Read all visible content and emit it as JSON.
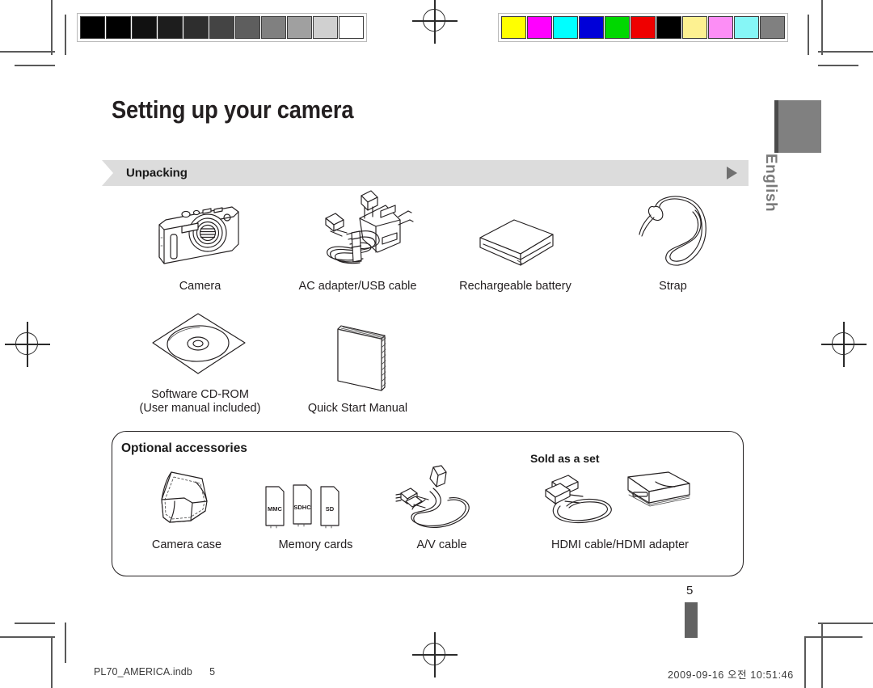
{
  "document": {
    "page_title": "Setting up your camera",
    "section_banner": "Unpacking",
    "language_tab": "English",
    "page_number": "5"
  },
  "calibration": {
    "gray_bar_label": "grayscale-calibration-bar",
    "gray_swatches": [
      "#000000",
      "#010101",
      "#111111",
      "#1d1d1d",
      "#2e2e2e",
      "#444444",
      "#5e5e5e",
      "#808080",
      "#a0a0a0",
      "#d0d0d0",
      "#ffffff"
    ],
    "color_bar_label": "color-calibration-bar",
    "color_swatches": [
      "#ffff00",
      "#ff00ff",
      "#00ffff",
      "#0000d8",
      "#00d800",
      "#ef0000",
      "#000000",
      "#fdf191",
      "#fc8ef5",
      "#86f6f6",
      "#808080"
    ]
  },
  "unpacking": {
    "row1": [
      {
        "caption": "Camera",
        "icon": "camera-icon"
      },
      {
        "caption": "AC adapter/USB cable",
        "icon": "ac-adapter-usb-cable-icon"
      },
      {
        "caption": "Rechargeable battery",
        "icon": "battery-icon"
      },
      {
        "caption": "Strap",
        "icon": "strap-icon"
      }
    ],
    "row2": [
      {
        "caption": "Software CD-ROM",
        "caption2": "(User manual included)",
        "icon": "cd-rom-icon"
      },
      {
        "caption": "Quick Start Manual",
        "caption2": "",
        "icon": "manual-icon"
      }
    ]
  },
  "optional": {
    "title": "Optional accessories",
    "sold_as_set": "Sold as a set",
    "items": [
      {
        "caption": "Camera case",
        "icon": "camera-case-icon"
      },
      {
        "caption": "Memory cards",
        "icon": "memory-cards-icon"
      },
      {
        "caption": "A/V cable",
        "icon": "av-cable-icon"
      },
      {
        "caption": "HDMI cable/HDMI adapter",
        "icon": "hdmi-cable-adapter-icon"
      }
    ],
    "memory_card_labels": [
      "MMC",
      "SDHC",
      "SD"
    ]
  },
  "footer": {
    "file_name": "PL70_AMERICA.indb",
    "file_page": "5",
    "timestamp": "2009-09-16  오전 10:51:46"
  },
  "colors": {
    "banner_gray": "#dcdcdc",
    "tab_gray": "#808080",
    "line_black": "#231f20"
  }
}
